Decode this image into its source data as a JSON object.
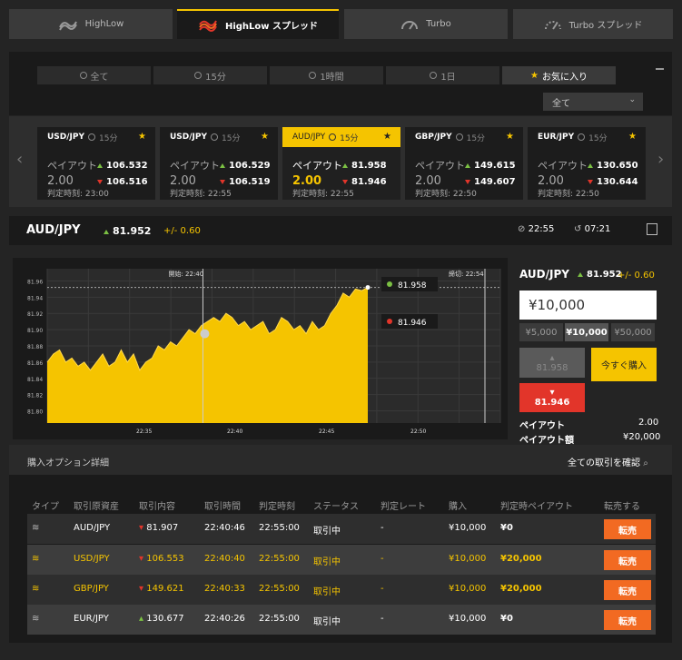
{
  "top_tabs": [
    {
      "label": "HighLow",
      "icon": "highlow-icon",
      "active": false
    },
    {
      "label": "HighLow スプレッド",
      "icon": "highlow-spread-icon",
      "active": true
    },
    {
      "label": "Turbo",
      "icon": "turbo-gauge-icon",
      "active": false
    },
    {
      "label": "Turbo スプレッド",
      "icon": "turbo-spread-gauge-icon",
      "active": false
    }
  ],
  "filter_tabs": [
    {
      "label": "全て",
      "icon": "clock-icon"
    },
    {
      "label": "15分",
      "icon": "clock-icon"
    },
    {
      "label": "1時間",
      "icon": "clock-icon"
    },
    {
      "label": "1日",
      "icon": "clock-icon"
    },
    {
      "label": "お気に入り",
      "icon": "star-icon",
      "active": true
    }
  ],
  "dropdown": {
    "value": "全て"
  },
  "cards": [
    {
      "pair": "USD/JPY",
      "timeframe": "15分",
      "payout_label": "ペイアウト",
      "payout": "2.00",
      "high": "106.532",
      "low": "106.516",
      "expiry": "判定時刻: 23:00",
      "active": false
    },
    {
      "pair": "USD/JPY",
      "timeframe": "15分",
      "payout_label": "ペイアウト",
      "payout": "2.00",
      "high": "106.529",
      "low": "106.519",
      "expiry": "判定時刻: 22:55",
      "active": false
    },
    {
      "pair": "AUD/JPY",
      "timeframe": "15分",
      "payout_label": "ペイアウト",
      "payout": "2.00",
      "high": "81.958",
      "low": "81.946",
      "expiry": "判定時刻: 22:55",
      "active": true
    },
    {
      "pair": "GBP/JPY",
      "timeframe": "15分",
      "payout_label": "ペイアウト",
      "payout": "2.00",
      "high": "149.615",
      "low": "149.607",
      "expiry": "判定時刻: 22:50",
      "active": false
    },
    {
      "pair": "EUR/JPY",
      "timeframe": "15分",
      "payout_label": "ペイアウト",
      "payout": "2.00",
      "high": "130.650",
      "low": "130.644",
      "expiry": "判定時刻: 22:50",
      "active": false
    }
  ],
  "detail": {
    "pair": "AUD/JPY",
    "price": "81.952",
    "change": "+/- 0.60",
    "close_time": "22:55",
    "remaining": "07:21"
  },
  "chart_data": {
    "type": "area",
    "start_label": "開始: 22:40",
    "end_label": "締切: 22:54",
    "x_ticks": [
      "22:35",
      "22:40",
      "22:45",
      "22:50"
    ],
    "y_ticks": [
      "81.80",
      "81.82",
      "81.84",
      "81.86",
      "81.88",
      "81.90",
      "81.92",
      "81.94",
      "81.96"
    ],
    "high_label": "81.958",
    "low_label": "81.946",
    "values": [
      81.86,
      81.87,
      81.875,
      81.86,
      81.865,
      81.855,
      81.86,
      81.85,
      81.86,
      81.87,
      81.855,
      81.86,
      81.875,
      81.86,
      81.87,
      81.85,
      81.86,
      81.865,
      81.88,
      81.875,
      81.885,
      81.88,
      81.89,
      81.9,
      81.895,
      81.905,
      81.91,
      81.915,
      81.91,
      81.92,
      81.915,
      81.905,
      81.91,
      81.9,
      81.905,
      81.91,
      81.895,
      81.9,
      81.915,
      81.91,
      81.9,
      81.905,
      81.895,
      81.91,
      81.9,
      81.905,
      81.92,
      81.93,
      81.945,
      81.94,
      81.95,
      81.948,
      81.952
    ],
    "ylim": [
      81.785,
      81.975
    ]
  },
  "order": {
    "pair": "AUD/JPY",
    "price": "81.952",
    "change": "+/- 0.60",
    "amount": "¥10,000",
    "presets": [
      "¥5,000",
      "¥10,000",
      "¥50,000"
    ],
    "active_preset": 1,
    "high_rate": "81.958",
    "low_rate": "81.946",
    "buy_now": "今すぐ購入",
    "payout_label": "ペイアウト",
    "payout_value": "2.00",
    "payout_amount_label": "ペイアウト額",
    "payout_amount_value": "¥20,000"
  },
  "purchase": {
    "title": "購入オプション詳細",
    "view_all": "全ての取引を確認",
    "headers": [
      "タイプ",
      "取引原資産",
      "取引内容",
      "取引時間",
      "判定時刻",
      "ステータス",
      "判定レート",
      "購入",
      "判定時ペイアウト",
      "転売する"
    ],
    "rows": [
      {
        "asset": "AUD/JPY",
        "direction": "down",
        "rate": "81.907",
        "time": "22:40:46",
        "expiry": "22:55:00",
        "status": "取引中",
        "judge": "-",
        "amount": "¥10,000",
        "payout": "¥0",
        "sell": "転売",
        "highlight": false
      },
      {
        "asset": "USD/JPY",
        "direction": "down",
        "rate": "106.553",
        "time": "22:40:40",
        "expiry": "22:55:00",
        "status": "取引中",
        "judge": "-",
        "amount": "¥10,000",
        "payout": "¥20,000",
        "sell": "転売",
        "highlight": true
      },
      {
        "asset": "GBP/JPY",
        "direction": "down",
        "rate": "149.621",
        "time": "22:40:33",
        "expiry": "22:55:00",
        "status": "取引中",
        "judge": "-",
        "amount": "¥10,000",
        "payout": "¥20,000",
        "sell": "転売",
        "highlight": true
      },
      {
        "asset": "EUR/JPY",
        "direction": "up",
        "rate": "130.677",
        "time": "22:40:26",
        "expiry": "22:55:00",
        "status": "取引中",
        "judge": "-",
        "amount": "¥10,000",
        "payout": "¥0",
        "sell": "転売",
        "highlight": false
      }
    ]
  }
}
